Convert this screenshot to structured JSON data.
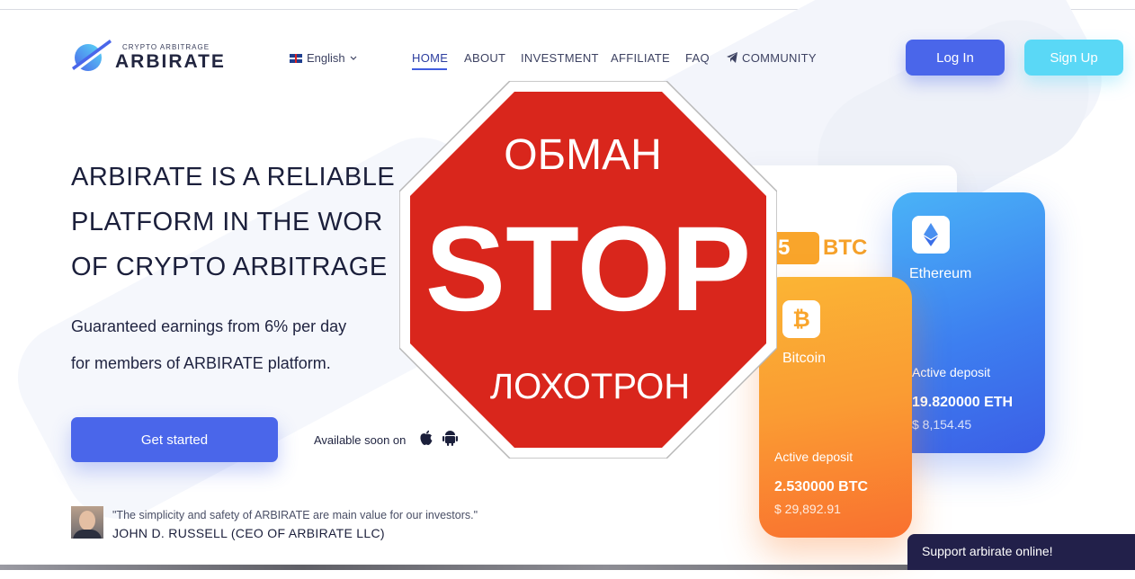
{
  "header": {
    "logo_sub": "CRYPTO ARBITRAGE",
    "logo_name": "ARBIRATE",
    "language": "English",
    "nav": [
      "HOME",
      "ABOUT",
      "INVESTMENT",
      "AFFILIATE",
      "FAQ",
      "COMMUNITY"
    ],
    "login_label": "Log In",
    "signup_label": "Sign Up"
  },
  "hero": {
    "lines": [
      "ARBIRATE IS A RELIABLE",
      "PLATFORM IN THE WOR",
      "OF CRYPTO ARBITRAGE"
    ],
    "sub_lines": [
      "Guaranteed earnings from 6% per day",
      "for members of ARBIRATE platform."
    ],
    "cta_label": "Get started",
    "available_text": "Available soon on"
  },
  "testimonial": {
    "quote": "\"The simplicity and safety of ARBIRATE are main value for our investors.\"",
    "author": "JOHN D. RUSSELL (CEO OF ARBIRATE LLC)"
  },
  "stop_sign": {
    "top": "ОБМАН",
    "middle": "STOP",
    "bottom": "ЛОХОТРОН",
    "color": "#d9261c"
  },
  "cards": {
    "btc_banner_value": "5",
    "btc_banner_unit": "BTC",
    "ethereum": {
      "name": "Ethereum",
      "deposit_label": "Active deposit",
      "amount": "19.820000 ETH",
      "usd": "$ 8,154.45"
    },
    "bitcoin": {
      "name": "Bitcoin",
      "deposit_label": "Active deposit",
      "amount": "2.530000 BTC",
      "usd": "$ 29,892.91"
    }
  },
  "chat": {
    "label": "Support arbirate online!"
  },
  "icons": {
    "apple": "apple-icon",
    "android": "android-icon",
    "telegram": "telegram-icon",
    "ethereum": "ethereum-icon",
    "bitcoin": "bitcoin-icon"
  },
  "colors": {
    "primary": "#4a66ea",
    "accent": "#5ad8f6",
    "bitcoin": "#f9a52b"
  }
}
